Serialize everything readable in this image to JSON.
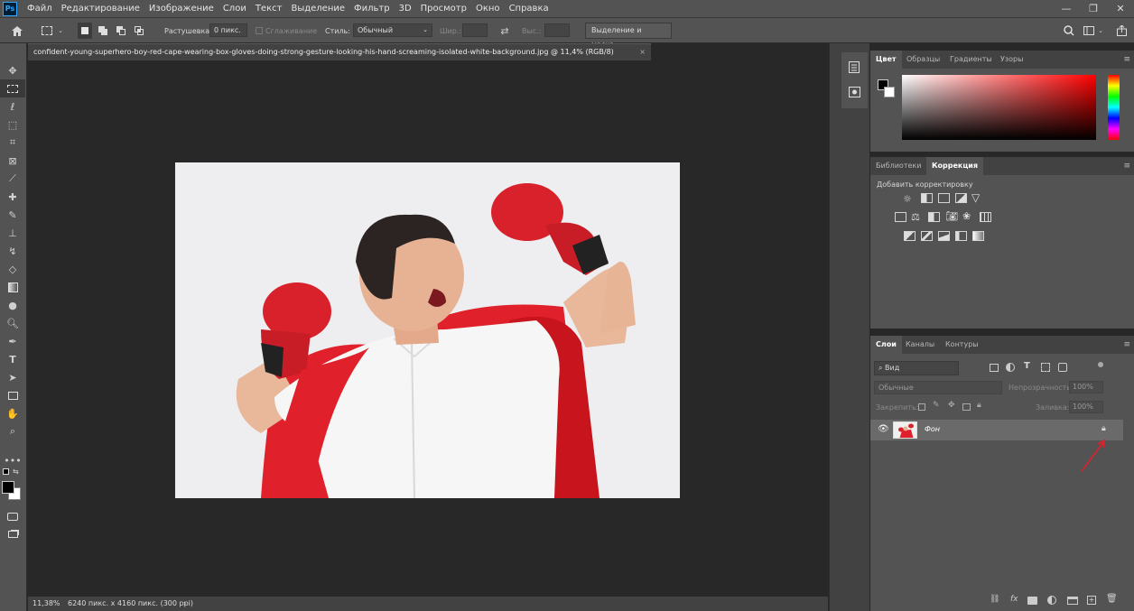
{
  "app": {
    "logo": "Ps"
  },
  "menu": [
    "Файл",
    "Редактирование",
    "Изображение",
    "Слои",
    "Текст",
    "Выделение",
    "Фильтр",
    "3D",
    "Просмотр",
    "Окно",
    "Справка"
  ],
  "options": {
    "feather_label": "Растушевка:",
    "feather_value": "0 пикс.",
    "antialias_label": "Сглаживание",
    "style_label": "Стиль:",
    "style_value": "Обычный",
    "width_label": "Шир.:",
    "height_label": "Выс.:",
    "mask_button": "Выделение и маска..."
  },
  "document": {
    "tab_title": "confident-young-superhero-boy-red-cape-wearing-box-gloves-doing-strong-gesture-looking-his-hand-screaming-isolated-white-background.jpg @ 11,4% (RGB/8)",
    "close": "×"
  },
  "status": {
    "zoom": "11,38%",
    "info": "6240 пикс. x 4160 пикс. (300 ppi)",
    "arrow": "›"
  },
  "color_panel": {
    "tabs": [
      "Цвет",
      "Образцы",
      "Градиенты",
      "Узоры"
    ]
  },
  "adjust_panel": {
    "tabs": [
      "Библиотеки",
      "Коррекция"
    ],
    "hint": "Добавить корректировку"
  },
  "layers_panel": {
    "tabs": [
      "Слои",
      "Каналы",
      "Контуры"
    ],
    "filter_kind": "Вид",
    "blend_mode": "Обычные",
    "opacity_label": "Непрозрачность:",
    "opacity_value": "100%",
    "lock_label": "Закрепить:",
    "fill_label": "Заливка:",
    "fill_value": "100%",
    "layers": [
      {
        "name": "Фон",
        "visible": true,
        "locked": true
      }
    ]
  },
  "colors": {
    "accent_red": "#e0202a",
    "ui_dark": "#535353"
  }
}
